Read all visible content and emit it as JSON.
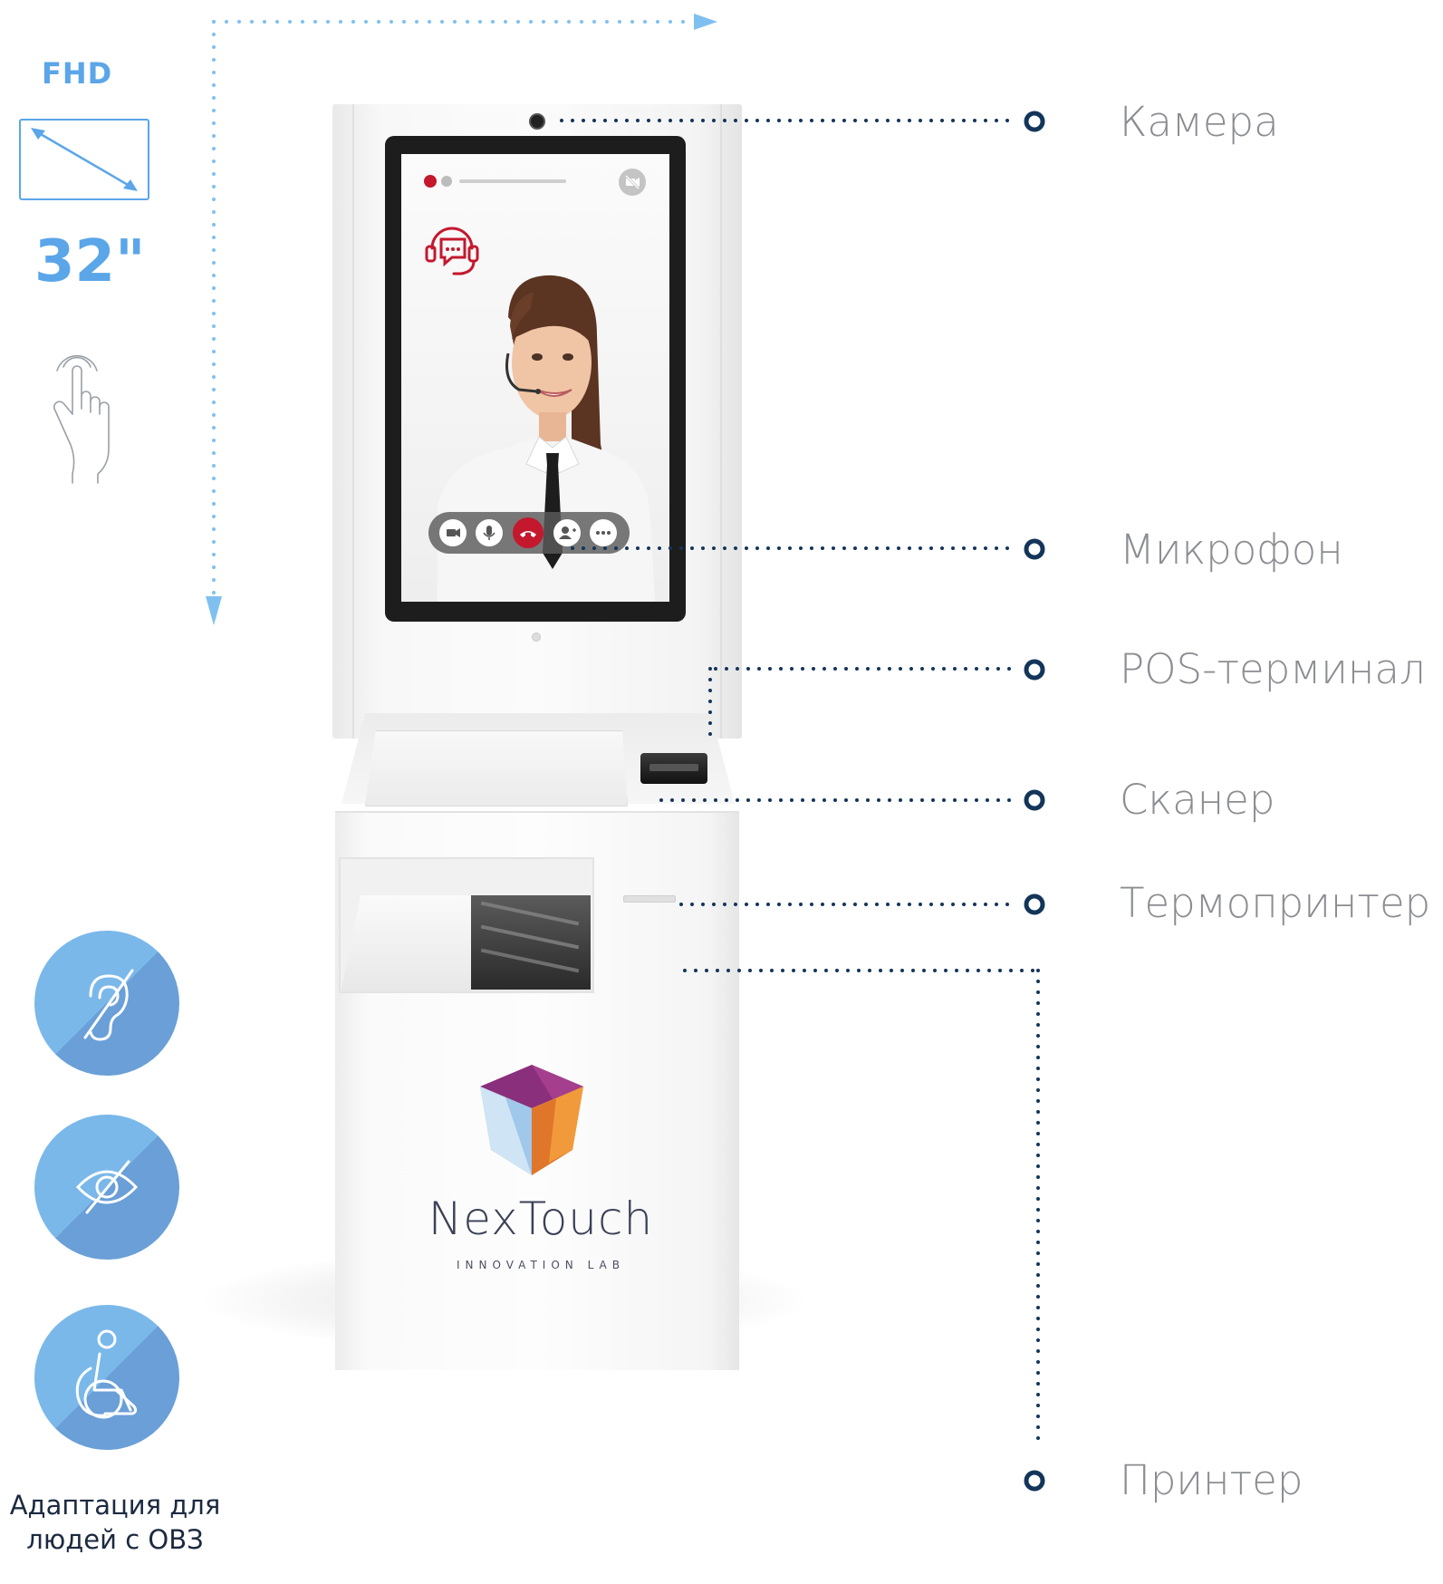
{
  "spec": {
    "resolution_label": "FHD",
    "screen_size": "32\"",
    "icons": [
      "monitor-diagonal-icon",
      "touch-hand-icon"
    ]
  },
  "callouts": [
    {
      "label": "Камера"
    },
    {
      "label": "Микрофон"
    },
    {
      "label": "POS-терминал"
    },
    {
      "label": "Сканер"
    },
    {
      "label": "Термопринтер"
    },
    {
      "label": "Принтер"
    }
  ],
  "accessibility": {
    "icons": [
      "deaf-icon",
      "blind-icon",
      "wheelchair-icon"
    ],
    "caption": "Адаптация для людей с ОВЗ"
  },
  "brand": {
    "name": "NexTouch",
    "tagline": "INNOVATION LAB"
  },
  "colors": {
    "accent_blue": "#5aa6e8",
    "dotted_blue": "#7fc0f0",
    "callout_navy": "#13355a",
    "label_gray": "#8b8d92",
    "call_red": "#c4182d"
  }
}
